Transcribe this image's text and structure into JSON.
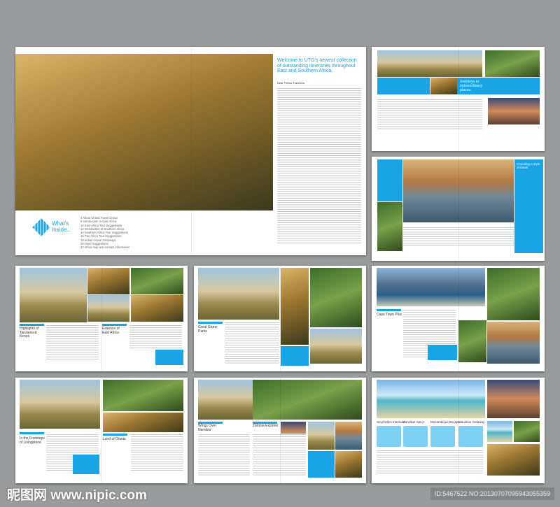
{
  "spread1": {
    "heading": "Welcome to UTG's newest collection of outstanding itineraries throughout East and Southern Africa.",
    "salutation": "Dear Fellow Travelers",
    "whats_inside": "What's Inside...",
    "contents": [
      "4  About United Travel Group",
      "5  Introduction to East Africa",
      "10  East Africa Tour Suggestions",
      "12  Introduction to Southern Africa",
      "14  Southern Africa Tour Suggestions",
      "16  Pan Africa Tour Suggestions",
      "18  Indian Ocean Getaways",
      "20  Hotel Suggestions",
      "22  Africa map and contact information"
    ]
  },
  "spread2": {
    "heading": "Journeys to extraordinary places."
  },
  "spread3": {
    "heading": "Choosing a style of travel"
  },
  "spread4": {
    "titles": [
      "Highlights of Tanzania & Kenya",
      "Essence of East Africa"
    ]
  },
  "spread5": {
    "titles": [
      "Great Game Parks"
    ]
  },
  "spread6": {
    "titles": [
      "Cape Town Plus"
    ]
  },
  "spread7": {
    "titles": [
      "In the Footsteps of Livingstone",
      "Land of Giants"
    ]
  },
  "spread8": {
    "titles": [
      "Wings Over Namibia",
      "Zambia Explorer"
    ]
  },
  "spread9": {
    "titles": [
      "Seychelles Interlude",
      "Zanzibar Spice",
      "Mozambique Escape",
      "Mauritius Getaway"
    ]
  },
  "watermark": {
    "site": "昵图网 www.nipic.com",
    "id": "ID:5467522 NO:20130707095943055359"
  },
  "colors": {
    "accent": "#19a4e6",
    "background": "#9a9b9d"
  }
}
